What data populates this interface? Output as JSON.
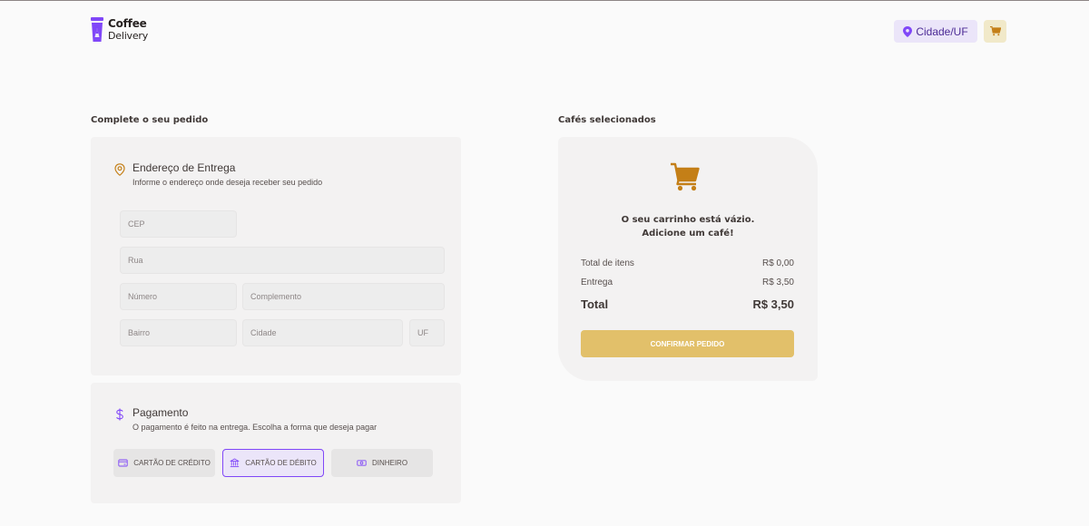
{
  "header": {
    "logo": {
      "line1": "Coffee",
      "line2": "Delivery"
    },
    "location_label": "Cidade/UF"
  },
  "order_form": {
    "section_title": "Complete o seu pedido",
    "address": {
      "title": "Endereço de Entrega",
      "subtitle": "Informe o endereço onde deseja receber seu pedido",
      "fields": {
        "cep": {
          "placeholder": "CEP",
          "value": ""
        },
        "rua": {
          "placeholder": "Rua",
          "value": ""
        },
        "numero": {
          "placeholder": "Número",
          "value": ""
        },
        "complemento": {
          "placeholder": "Complemento",
          "value": ""
        },
        "bairro": {
          "placeholder": "Bairro",
          "value": ""
        },
        "cidade": {
          "placeholder": "Cidade",
          "value": ""
        },
        "uf": {
          "placeholder": "UF",
          "value": ""
        }
      }
    },
    "payment": {
      "title": "Pagamento",
      "subtitle": "O pagamento é feito na entrega. Escolha a forma que deseja pagar",
      "options": [
        "Cartão de crédito",
        "Cartão de débito",
        "Dinheiro"
      ],
      "selected": "Cartão de débito"
    }
  },
  "cart": {
    "section_title": "Cafés selecionados",
    "empty_line1": "O seu carrinho está vázio.",
    "empty_line2": "Adicione um café!",
    "items_total_label": "Total de itens",
    "items_total_value": "R$ 0,00",
    "delivery_label": "Entrega",
    "delivery_value": "R$ 3,50",
    "total_label": "Total",
    "total_value": "R$ 3,50",
    "confirm_label": "Confirmar pedido"
  },
  "colors": {
    "brand_purple": "#8047f8",
    "purple_light": "#ebe5f9",
    "yellow": "#dbac2c",
    "yellow_dark": "#c47f17",
    "yellow_light": "#f1e9c9",
    "confirm_button": "#e2c06a"
  },
  "icons": {
    "logo": "coffee-cup-logo-icon",
    "location": "map-pin-icon",
    "cart": "shopping-cart-icon",
    "address": "map-pin-outline-icon",
    "payment": "currency-dollar-icon",
    "credit": "credit-card-icon",
    "debit": "bank-icon",
    "cash": "money-icon"
  }
}
